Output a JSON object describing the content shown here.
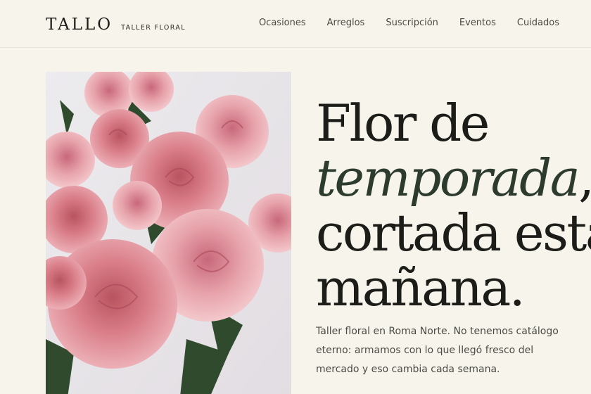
{
  "header": {
    "brand_name": "TALLO",
    "brand_tagline": "TALLER FLORAL",
    "nav": [
      {
        "label": "Ocasiones"
      },
      {
        "label": "Arreglos"
      },
      {
        "label": "Suscripción"
      },
      {
        "label": "Eventos"
      },
      {
        "label": "Cuidados"
      }
    ]
  },
  "hero": {
    "headline_line1": "Flor de",
    "headline_accent": "temporada",
    "headline_comma": ",",
    "headline_line3": "cortada esta",
    "headline_line4": "mañana.",
    "intro": "Taller floral en Roma Norte. No tenemos catálogo eterno: armamos con lo que llegó fresco del mercado y eso cambia cada semana.",
    "accent_color": "#2c3b2e"
  }
}
